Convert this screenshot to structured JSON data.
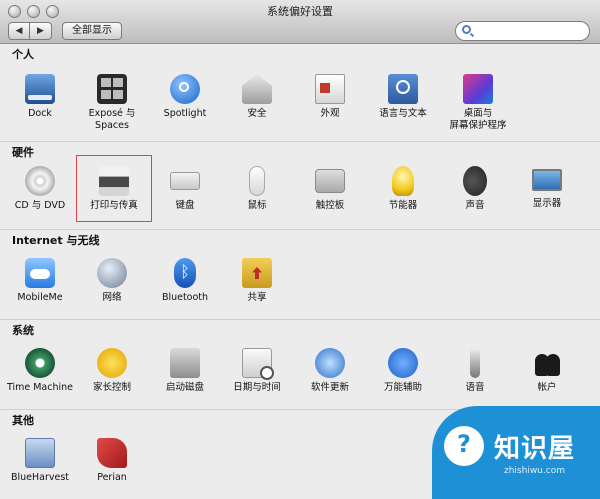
{
  "window": {
    "title": "系统偏好设置"
  },
  "toolbar": {
    "back_icon": "back-arrow-icon",
    "forward_icon": "forward-arrow-icon",
    "show_all_label": "全部显示",
    "search_placeholder": ""
  },
  "sections": {
    "personal": {
      "title": "个人",
      "items": [
        {
          "label": "Dock",
          "icon": "dock-icon"
        },
        {
          "label": "Exposé 与\nSpaces",
          "icon": "expose-icon"
        },
        {
          "label": "Spotlight",
          "icon": "spotlight-icon"
        },
        {
          "label": "安全",
          "icon": "security-icon"
        },
        {
          "label": "外观",
          "icon": "appearance-icon"
        },
        {
          "label": "语言与文本",
          "icon": "language-icon"
        },
        {
          "label": "桌面与\n屏幕保护程序",
          "icon": "desktop-icon"
        }
      ]
    },
    "hardware": {
      "title": "硬件",
      "items": [
        {
          "label": "CD 与 DVD",
          "icon": "cd-icon"
        },
        {
          "label": "打印与传真",
          "icon": "printer-icon"
        },
        {
          "label": "键盘",
          "icon": "keyboard-icon"
        },
        {
          "label": "鼠标",
          "icon": "mouse-icon"
        },
        {
          "label": "触控板",
          "icon": "trackpad-icon"
        },
        {
          "label": "节能器",
          "icon": "energy-saver-icon"
        },
        {
          "label": "声音",
          "icon": "sound-icon"
        },
        {
          "label": "显示器",
          "icon": "display-icon"
        }
      ]
    },
    "internet": {
      "title": "Internet 与无线",
      "items": [
        {
          "label": "MobileMe",
          "icon": "mobileme-icon"
        },
        {
          "label": "网络",
          "icon": "network-icon"
        },
        {
          "label": "Bluetooth",
          "icon": "bluetooth-icon"
        },
        {
          "label": "共享",
          "icon": "sharing-icon"
        }
      ]
    },
    "system": {
      "title": "系统",
      "items": [
        {
          "label": "Time Machine",
          "icon": "time-machine-icon"
        },
        {
          "label": "家长控制",
          "icon": "parental-controls-icon"
        },
        {
          "label": "启动磁盘",
          "icon": "startup-disk-icon"
        },
        {
          "label": "日期与时间",
          "icon": "date-time-icon"
        },
        {
          "label": "软件更新",
          "icon": "software-update-icon"
        },
        {
          "label": "万能辅助",
          "icon": "accessibility-icon"
        },
        {
          "label": "语音",
          "icon": "speech-icon"
        },
        {
          "label": "帐户",
          "icon": "accounts-icon"
        }
      ]
    },
    "other": {
      "title": "其他",
      "items": [
        {
          "label": "BlueHarvest",
          "icon": "blueharvest-icon"
        },
        {
          "label": "Perian",
          "icon": "perian-icon"
        }
      ]
    }
  },
  "highlighted_item": "打印与传真",
  "watermark": {
    "text": "知识屋",
    "sub": "zhishiwu.com",
    "color": "#1e90d5"
  }
}
